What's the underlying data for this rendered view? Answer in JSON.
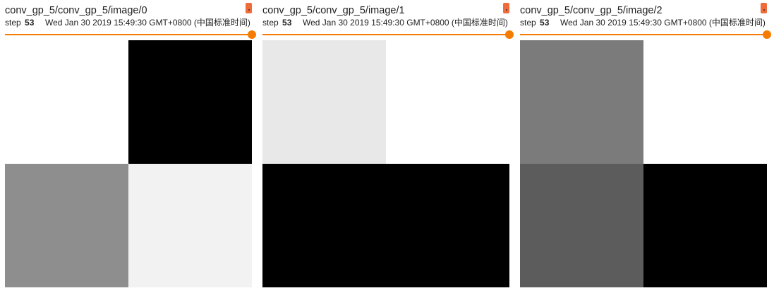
{
  "step_label": "step",
  "panels": [
    {
      "title": "conv_gp_5/conv_gp_5/image/0",
      "step": "53",
      "wall_time": "Wed Jan 30 2019 15:49:30 GMT+0800 (中国标准时间)",
      "pixels": [
        [
          "#ffffff",
          "#000000"
        ],
        [
          "#8e8e8e",
          "#f2f2f2"
        ]
      ]
    },
    {
      "title": "conv_gp_5/conv_gp_5/image/1",
      "step": "53",
      "wall_time": "Wed Jan 30 2019 15:49:30 GMT+0800 (中国标准时间)",
      "pixels": [
        [
          "#e8e8e8",
          "#ffffff"
        ],
        [
          "#000000",
          "#000000"
        ]
      ]
    },
    {
      "title": "conv_gp_5/conv_gp_5/image/2",
      "step": "53",
      "wall_time": "Wed Jan 30 2019 15:49:30 GMT+0800 (中国标准时间)",
      "pixels": [
        [
          "#7b7b7b",
          "#ffffff"
        ],
        [
          "#5c5c5c",
          "#000000"
        ]
      ]
    }
  ],
  "colors": {
    "accent": "#f57c00",
    "menu_button": "#ef6c3a"
  },
  "icons": {
    "menu": "more-vert-icon"
  }
}
